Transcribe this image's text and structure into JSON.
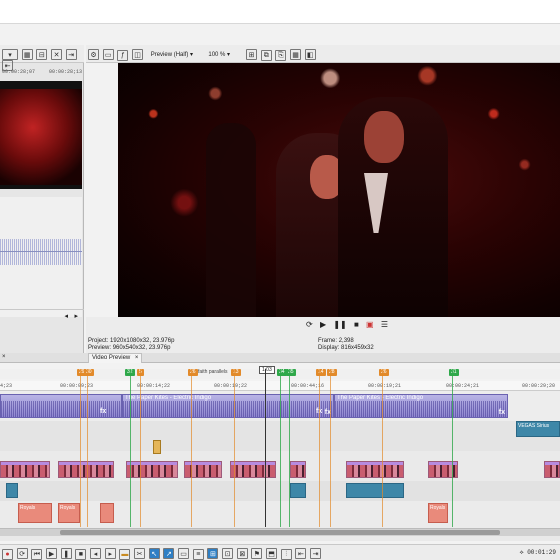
{
  "preview_toolbar": {
    "quality": "Preview (Half)",
    "zoom": "100 %"
  },
  "trimmer": {
    "time_left": "00:00:28;07",
    "time_right": "00:00:28;13"
  },
  "preview": {
    "project_label": "Project:",
    "project_value": "1920x1080x32, 23.976p",
    "preview_label": "Preview:",
    "preview_value": "960x540x32, 23.976p",
    "frame_label": "Frame:",
    "frame_value": "2,398",
    "display_label": "Display:",
    "display_value": "816x459x32",
    "tab_label": "Video Preview"
  },
  "timeline": {
    "ruler": [
      "00:00:09;23",
      "00:00:14;22",
      "00:00:19;22",
      "00:00:44;16",
      "00:00:19;21",
      "00:00:24;21",
      "00:00:29;20"
    ],
    "ruler_left": "4;23",
    "markers": [
      {
        "label": "29",
        "color": "orange"
      },
      {
        "label": "30",
        "color": "orange"
      },
      {
        "label": "32",
        "color": "green"
      },
      {
        "label": "5",
        "color": "orange"
      },
      {
        "label": "26",
        "color": "orange"
      },
      {
        "label": "faith parallels",
        "color": "none"
      },
      {
        "label": "13",
        "color": "orange"
      },
      {
        "label": "34",
        "color": "green"
      },
      {
        "label": "35",
        "color": "green"
      },
      {
        "label": "14",
        "color": "orange"
      },
      {
        "label": "28",
        "color": "orange"
      },
      {
        "label": "26",
        "color": "orange"
      },
      {
        "label": "31",
        "color": "green"
      }
    ],
    "playhead_label": "1:03",
    "audio_clip_1": "The Paper Kites - Electric Indigo",
    "audio_clip_2": "The Paper Kites - Electric Indigo",
    "right_clip": "VEGAS Sirius",
    "small_clip_label": "Royals",
    "end_time": "00:01:29"
  },
  "colors": {
    "accent": "#2f7fc4",
    "audio": "#8f86d0",
    "marker_orange": "#e28a2a",
    "marker_green": "#2fa84a"
  }
}
